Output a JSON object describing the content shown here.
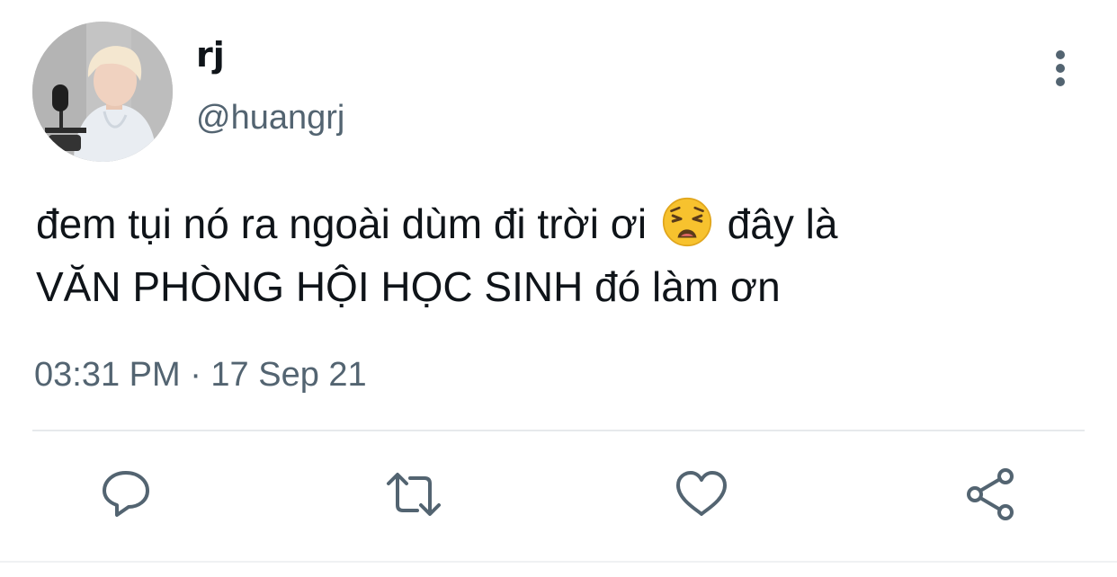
{
  "tweet": {
    "display_name": "rj",
    "handle": "@huangrj",
    "text_line1_before_emoji": "đem tụi nó ra ngoài dùm đi trời ơi ",
    "text_line1_after_emoji": " đây là",
    "text_line2": "VĂN PHÒNG HỘI HỌC SINH đó làm ơn",
    "emoji": "weary-face",
    "timestamp": "03:31 PM · 17 Sep 21"
  },
  "actions": [
    {
      "icon": "reply-icon"
    },
    {
      "icon": "retweet-icon"
    },
    {
      "icon": "like-icon"
    },
    {
      "icon": "share-icon"
    }
  ],
  "colors": {
    "text": "#0f1419",
    "secondary": "#536471",
    "divider": "#e6e9ec"
  }
}
